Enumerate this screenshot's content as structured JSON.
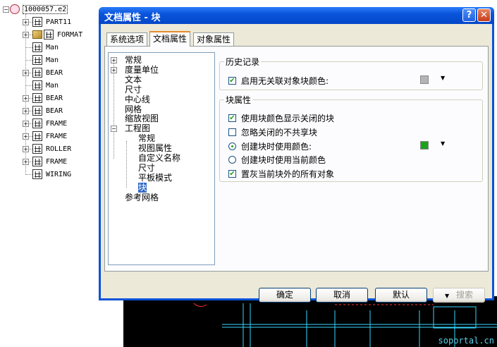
{
  "tree": {
    "root": "1000057.e2",
    "items": [
      {
        "label": "PART11",
        "expand": "+"
      },
      {
        "label": "FORMAT",
        "expand": "+"
      },
      {
        "label": "Man",
        "expand": ""
      },
      {
        "label": "Man",
        "expand": ""
      },
      {
        "label": "BEAR",
        "expand": "+"
      },
      {
        "label": "Man",
        "expand": ""
      },
      {
        "label": "BEAR",
        "expand": "+"
      },
      {
        "label": "BEAR",
        "expand": "+"
      },
      {
        "label": "FRAME",
        "expand": "+"
      },
      {
        "label": "FRAME",
        "expand": "+"
      },
      {
        "label": "ROLLER",
        "expand": "+"
      },
      {
        "label": "FRAME",
        "expand": "+"
      },
      {
        "label": "WIRING",
        "expand": ""
      }
    ]
  },
  "dialog": {
    "title": "文档属性 - 块",
    "help": "?",
    "close": "✕",
    "tabs": [
      "系统选项",
      "文档属性",
      "对象属性"
    ],
    "active_tab": 1,
    "options_tree": {
      "items": [
        {
          "label": "常规",
          "indent": 0,
          "expand": "+"
        },
        {
          "label": "度量单位",
          "indent": 0,
          "expand": "+"
        },
        {
          "label": "文本",
          "indent": 0,
          "expand": ""
        },
        {
          "label": "尺寸",
          "indent": 0,
          "expand": ""
        },
        {
          "label": "中心线",
          "indent": 0,
          "expand": ""
        },
        {
          "label": "网格",
          "indent": 0,
          "expand": ""
        },
        {
          "label": "缩放视图",
          "indent": 0,
          "expand": ""
        },
        {
          "label": "工程图",
          "indent": 0,
          "expand": "−"
        },
        {
          "label": "常规",
          "indent": 1,
          "expand": ""
        },
        {
          "label": "视图属性",
          "indent": 1,
          "expand": ""
        },
        {
          "label": "自定义名称",
          "indent": 1,
          "expand": ""
        },
        {
          "label": "尺寸",
          "indent": 1,
          "expand": ""
        },
        {
          "label": "平板模式",
          "indent": 1,
          "expand": ""
        },
        {
          "label": "块",
          "indent": 1,
          "expand": "",
          "selected": true
        },
        {
          "label": "参考网格",
          "indent": 0,
          "expand": ""
        }
      ]
    },
    "history_group": {
      "label": "历史记录",
      "enable_unassociated": {
        "label": "启用无关联对象块颜色:",
        "checked": true,
        "color": "#b4b4b4"
      }
    },
    "block_group": {
      "label": "块属性",
      "show_closed": {
        "label": "使用块颜色显示关闭的块",
        "checked": true
      },
      "ignore_unshared": {
        "label": "忽略关闭的不共享块",
        "checked": false
      },
      "create_use_color": {
        "label": "创建块时使用颜色:",
        "selected": true,
        "color": "#1aa21a"
      },
      "create_use_current": {
        "label": "创建块时使用当前颜色",
        "selected": false
      },
      "gray_outside": {
        "label": "置灰当前块外的所有对象",
        "checked": true
      }
    },
    "buttons": {
      "ok": "确定",
      "cancel": "取消",
      "default": "默认",
      "search": "搜索"
    }
  },
  "watermark": "soportal.cn"
}
